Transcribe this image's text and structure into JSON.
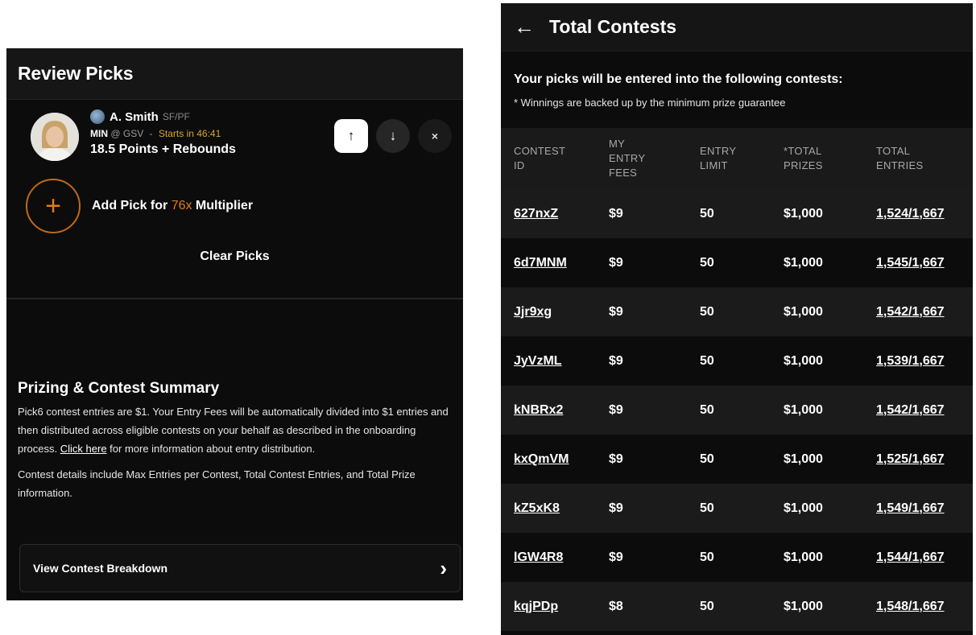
{
  "review": {
    "title": "Review Picks",
    "pick": {
      "player_name": "A. Smith",
      "position": "SF/PF",
      "team": "MIN",
      "opponent": "@ GSV",
      "separator": "-",
      "start_time": "Starts in 46:41",
      "stat_line": "18.5 Points + Rebounds"
    },
    "buttons": {
      "up": "↑",
      "down": "↓",
      "remove": "×"
    },
    "add_pick": {
      "prefix": "Add Pick for ",
      "multiplier": "76x",
      "suffix": " Multiplier",
      "icon": "+"
    },
    "clear_label": "Clear Picks",
    "summary": {
      "title": "Prizing & Contest Summary",
      "p1_before": "Pick6 contest entries are $1. Your Entry Fees will be automatically divided into $1 entries and then distributed across eligible contests on your behalf as described in the onboarding process. ",
      "p1_link": "Click here",
      "p1_after": " for more information about entry distribution.",
      "p2": "Contest details include Max Entries per Contest, Total Contest Entries, and Total Prize information."
    },
    "breakdown_label": "View Contest Breakdown",
    "breakdown_chevron": "›"
  },
  "contests": {
    "back_icon": "←",
    "title": "Total Contests",
    "lead": "Your picks will be entered into the following contests:",
    "note": "* Winnings are backed up by the minimum prize guarantee",
    "headers": [
      [
        "CONTEST",
        "ID"
      ],
      [
        "MY",
        "ENTRY",
        "FEES"
      ],
      [
        "ENTRY",
        "LIMIT"
      ],
      [
        "*TOTAL",
        "PRIZES"
      ],
      [
        "TOTAL",
        "ENTRIES"
      ]
    ],
    "rows": [
      {
        "id": "627nxZ",
        "fees": "$9",
        "limit": "50",
        "prizes": "$1,000",
        "entries": "1,524/1,667"
      },
      {
        "id": "6d7MNM",
        "fees": "$9",
        "limit": "50",
        "prizes": "$1,000",
        "entries": "1,545/1,667"
      },
      {
        "id": "Jjr9xg",
        "fees": "$9",
        "limit": "50",
        "prizes": "$1,000",
        "entries": "1,542/1,667"
      },
      {
        "id": "JyVzML",
        "fees": "$9",
        "limit": "50",
        "prizes": "$1,000",
        "entries": "1,539/1,667"
      },
      {
        "id": "kNBRx2",
        "fees": "$9",
        "limit": "50",
        "prizes": "$1,000",
        "entries": "1,542/1,667"
      },
      {
        "id": "kxQmVM",
        "fees": "$9",
        "limit": "50",
        "prizes": "$1,000",
        "entries": "1,525/1,667"
      },
      {
        "id": "kZ5xK8",
        "fees": "$9",
        "limit": "50",
        "prizes": "$1,000",
        "entries": "1,549/1,667"
      },
      {
        "id": "lGW4R8",
        "fees": "$9",
        "limit": "50",
        "prizes": "$1,000",
        "entries": "1,544/1,667"
      },
      {
        "id": "kqjPDp",
        "fees": "$8",
        "limit": "50",
        "prizes": "$1,000",
        "entries": "1,548/1,667"
      }
    ]
  },
  "colors": {
    "accent_orange": "#e07d19",
    "start_yellow": "#d4a72c",
    "panel_bg": "#0c0c0c"
  }
}
